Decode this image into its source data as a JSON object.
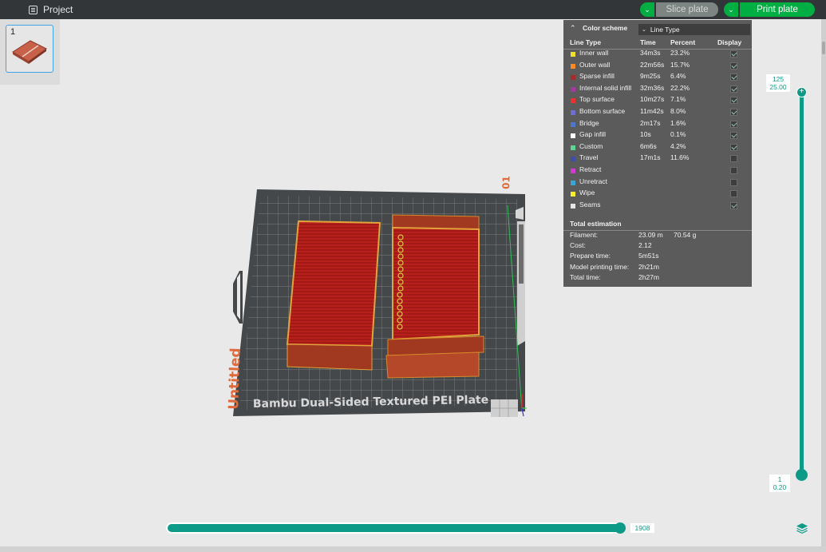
{
  "topbar": {
    "project_label": "Project",
    "slice_plate_label": "Slice plate",
    "print_plate_label": "Print plate"
  },
  "plates": [
    {
      "number": "1"
    }
  ],
  "plate_scene": {
    "plate_name": "Bambu Dual-Sided Textured PEI Plate",
    "project_name": "Untitled",
    "plate_index": "01"
  },
  "legend": {
    "title": "Color scheme",
    "scheme_value": "Line Type",
    "columns": {
      "line_type": "Line Type",
      "time": "Time",
      "percent": "Percent",
      "display": "Display"
    },
    "rows": [
      {
        "name": "Inner wall",
        "time": "34m3s",
        "percent": "23.2%",
        "color": "#f4e02a",
        "display": true
      },
      {
        "name": "Outer wall",
        "time": "22m56s",
        "percent": "15.7%",
        "color": "#ff8a24",
        "display": true
      },
      {
        "name": "Sparse infill",
        "time": "9m25s",
        "percent": "6.4%",
        "color": "#a82a2a",
        "display": true
      },
      {
        "name": "Internal solid infill",
        "time": "32m36s",
        "percent": "22.2%",
        "color": "#a33aa0",
        "display": true
      },
      {
        "name": "Top surface",
        "time": "10m27s",
        "percent": "7.1%",
        "color": "#f23030",
        "display": true
      },
      {
        "name": "Bottom surface",
        "time": "11m42s",
        "percent": "8.0%",
        "color": "#6f6fd0",
        "display": true
      },
      {
        "name": "Bridge",
        "time": "2m17s",
        "percent": "1.6%",
        "color": "#4f77c9",
        "display": true
      },
      {
        "name": "Gap infill",
        "time": "10s",
        "percent": "0.1%",
        "color": "#ffffff",
        "display": true
      },
      {
        "name": "Custom",
        "time": "6m6s",
        "percent": "4.2%",
        "color": "#5ed497",
        "display": true
      },
      {
        "name": "Travel",
        "time": "17m1s",
        "percent": "11.6%",
        "color": "#3f4fa8",
        "display": false
      },
      {
        "name": "Retract",
        "time": "",
        "percent": "",
        "color": "#d43ad1",
        "display": false
      },
      {
        "name": "Unretract",
        "time": "",
        "percent": "",
        "color": "#3aa6d1",
        "display": false
      },
      {
        "name": "Wipe",
        "time": "",
        "percent": "",
        "color": "#f5f02a",
        "display": false
      },
      {
        "name": "Seams",
        "time": "",
        "percent": "",
        "color": "#e6e6e6",
        "display": true
      }
    ],
    "total_label": "Total estimation",
    "estimation": [
      {
        "key": "Filament:",
        "value": "23.09 m",
        "value2": "70.54 g"
      },
      {
        "key": "Cost:",
        "value": "2.12",
        "value2": ""
      },
      {
        "key": "Prepare time:",
        "value": "5m51s",
        "value2": ""
      },
      {
        "key": "Model printing time:",
        "value": "2h21m",
        "value2": ""
      },
      {
        "key": "Total time:",
        "value": "2h27m",
        "value2": ""
      }
    ]
  },
  "layer_slider": {
    "top_layer": "125",
    "top_height": "25.00",
    "bottom_layer": "1",
    "bottom_height": "0.20"
  },
  "move_slider": {
    "value": "1908"
  }
}
